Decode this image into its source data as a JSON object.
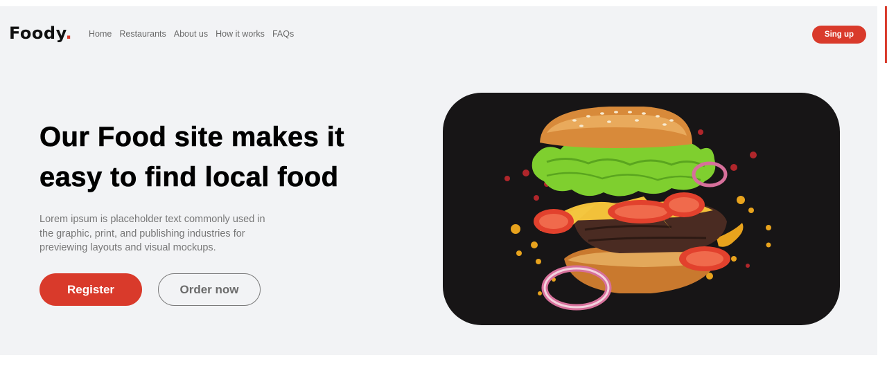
{
  "brand": {
    "name": "Foody",
    "dot": ".",
    "accent_color": "#d93a2b"
  },
  "nav": {
    "items": [
      {
        "label": "Home"
      },
      {
        "label": "Restaurants"
      },
      {
        "label": "About us"
      },
      {
        "label": "How it works"
      },
      {
        "label": "FAQs"
      }
    ],
    "signup_label": "Sing up"
  },
  "hero": {
    "headline_line1": "Our Food site makes it",
    "headline_line2": "easy to find local food",
    "description": "Lorem ipsum is placeholder text commonly used in the graphic, print, and publishing industries for previewing layouts and visual mockups.",
    "primary_button": "Register",
    "secondary_button": "Order now",
    "image_icon": "burger-image",
    "colors": {
      "background": "#f2f3f5",
      "image_panel": "#171516"
    }
  }
}
